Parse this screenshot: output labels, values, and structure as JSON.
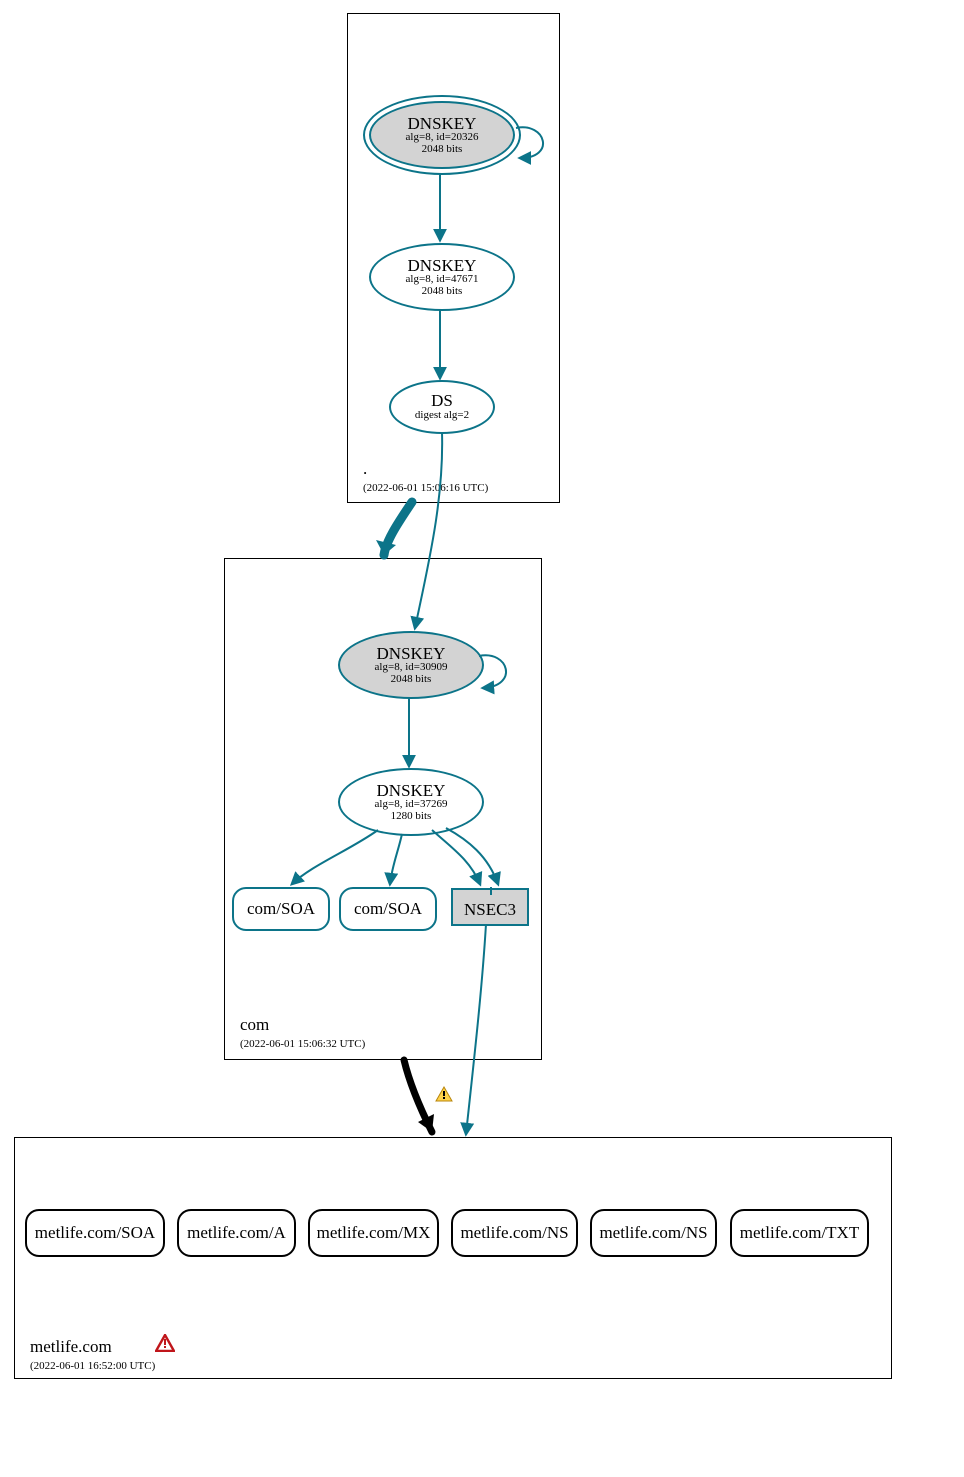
{
  "zones": {
    "root": {
      "name": ".",
      "ts": "(2022-06-01 15:06:16 UTC)"
    },
    "com": {
      "name": "com",
      "ts": "(2022-06-01 15:06:32 UTC)"
    },
    "leaf": {
      "name": "metlife.com",
      "ts": "(2022-06-01 16:52:00 UTC)"
    }
  },
  "nodes": {
    "root_ksk": {
      "title": "DNSKEY",
      "sub1": "alg=8, id=20326",
      "sub2": "2048 bits"
    },
    "root_zsk": {
      "title": "DNSKEY",
      "sub1": "alg=8, id=47671",
      "sub2": "2048 bits"
    },
    "root_ds": {
      "title": "DS",
      "sub1": "digest alg=2",
      "sub2": ""
    },
    "com_ksk": {
      "title": "DNSKEY",
      "sub1": "alg=8, id=30909",
      "sub2": "2048 bits"
    },
    "com_zsk": {
      "title": "DNSKEY",
      "sub1": "alg=8, id=37269",
      "sub2": "1280 bits"
    },
    "com_soa1": {
      "label": "com/SOA"
    },
    "com_soa2": {
      "label": "com/SOA"
    },
    "nsec3": {
      "label": "NSEC3"
    },
    "leaf_soa": {
      "label": "metlife.com/SOA"
    },
    "leaf_a": {
      "label": "metlife.com/A"
    },
    "leaf_mx": {
      "label": "metlife.com/MX"
    },
    "leaf_ns1": {
      "label": "metlife.com/NS"
    },
    "leaf_ns2": {
      "label": "metlife.com/NS"
    },
    "leaf_txt": {
      "label": "metlife.com/TXT"
    }
  },
  "colors": {
    "secure": "#0c7489",
    "grey": "#d3d3d3",
    "warn_y": "#ffd24a",
    "warn_r": "#c0151a"
  }
}
